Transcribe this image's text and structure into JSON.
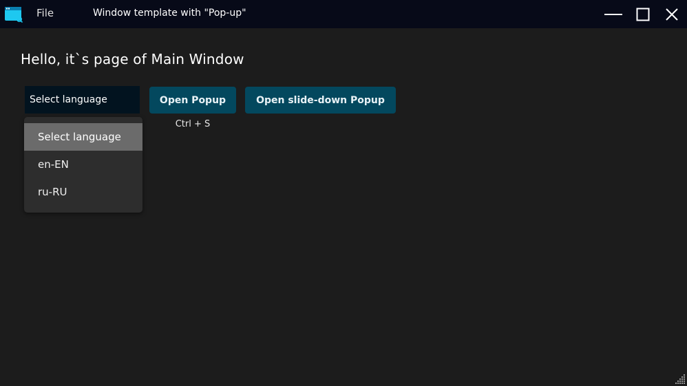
{
  "titlebar": {
    "app_icon": "window-app-icon",
    "menu_file": "File",
    "title": "Window template with \"Pop-up\"",
    "controls": {
      "minimize_icon": "minimize-icon",
      "maximize_icon": "maximize-icon",
      "close_icon": "close-icon"
    }
  },
  "main": {
    "heading": "Hello, it`s page of Main Window",
    "language_select": {
      "value": "Select language",
      "options": [
        "Select language",
        "en-EN",
        "ru-RU"
      ],
      "highlighted_option": "Select language"
    },
    "open_popup_label": "Open Popup",
    "open_popup_shortcut": "Ctrl + S",
    "open_slide_popup_label": "Open slide-down Popup"
  },
  "colors": {
    "titlebar_bg": "#070a18",
    "content_bg": "#1c1c1c",
    "button_bg": "#03485e",
    "select_bg": "#02131f",
    "dropdown_bg": "#2d2d2d",
    "dropdown_highlight": "#6b6b6b",
    "icon_accent": "#1ec8f0"
  },
  "resize_grip_icon": "resize-grip-icon"
}
